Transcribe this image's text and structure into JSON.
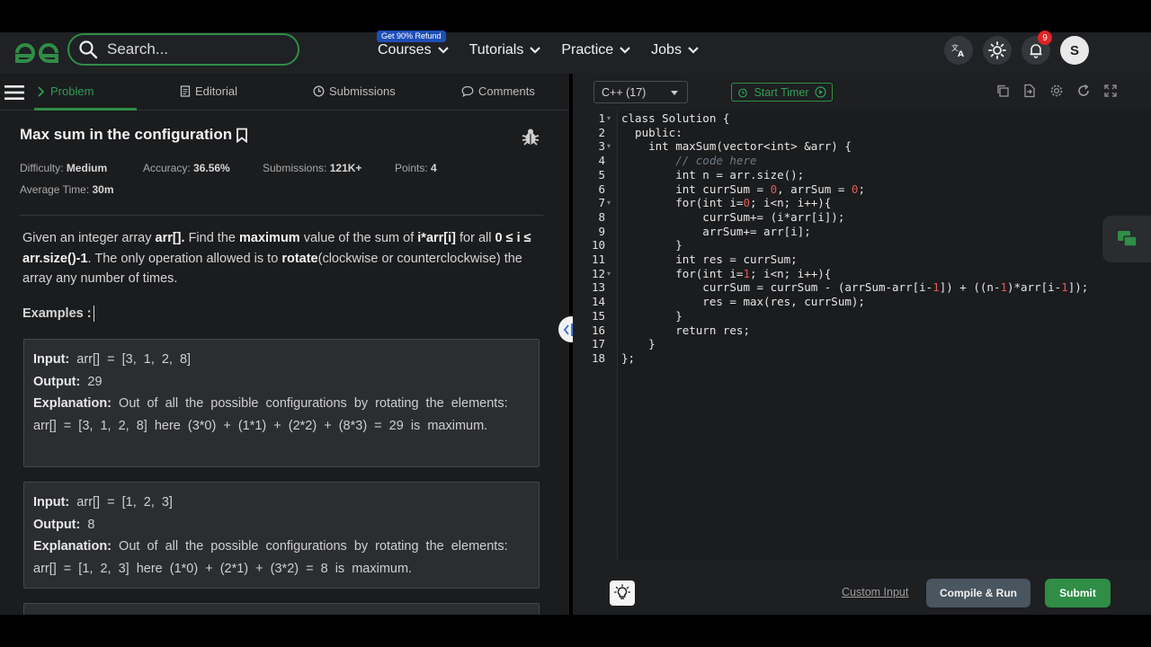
{
  "nav": {
    "search_placeholder": "Search...",
    "refund_badge": "Get 90% Refund",
    "menu": [
      "Courses",
      "Tutorials",
      "Practice",
      "Jobs"
    ],
    "notification_count": "9",
    "avatar_initial": "S",
    "brand_color": "#2f8d46"
  },
  "tabs": {
    "problem": "Problem",
    "editorial": "Editorial",
    "submissions": "Submissions",
    "comments": "Comments"
  },
  "problem": {
    "title": "Max sum in the configuration",
    "difficulty_label": "Difficulty:",
    "difficulty": "Medium",
    "accuracy_label": "Accuracy:",
    "accuracy": "36.56%",
    "submissions_label": "Submissions:",
    "submissions": "121K+",
    "points_label": "Points:",
    "points": "4",
    "avg_time_label": "Average Time:",
    "avg_time": "30m",
    "desc_1": "Given an integer array ",
    "desc_arr": "arr[].",
    "desc_2": " Find the ",
    "desc_max": "maximum",
    "desc_3": " value of the sum of ",
    "desc_expr": "i*arr[i]",
    "desc_4": " for all ",
    "desc_range": "0 ≤ i ≤ arr.size()-1",
    "desc_5": ". The only operation allowed is to ",
    "desc_rotate": "rotate",
    "desc_6": "(clockwise or counterclockwise) the array any number of times.",
    "examples_label": "Examples :",
    "examples": [
      {
        "input_label": "Input:",
        "input": "arr[] = [3, 1, 2, 8]",
        "output_label": "Output:",
        "output": "29",
        "explanation_label": "Explanation:",
        "explanation": "Out of all the possible configurations by rotating the elements: arr[] = [3, 1, 2, 8] here (3*0) + (1*1) + (2*2) + (8*3) = 29 is maximum."
      },
      {
        "input_label": "Input:",
        "input": "arr[] = [1, 2, 3]",
        "output_label": "Output:",
        "output": "8",
        "explanation_label": "Explanation:",
        "explanation": "Out of all the possible configurations by rotating the elements: arr[] = [1, 2, 3] here (1*0) + (2*1) + (3*2) = 8 is maximum."
      }
    ]
  },
  "editor": {
    "language": "C++ (17)",
    "timer_label": "Start Timer",
    "custom_input": "Custom Input",
    "compile_run": "Compile & Run",
    "submit": "Submit",
    "code_lines": [
      "class Solution {",
      "  public:",
      "    int maxSum(vector<int> &arr) {",
      "        // code here",
      "        int n = arr.size();",
      "        int currSum = 0, arrSum = 0;",
      "        for(int i=0; i<n; i++){",
      "            currSum+= (i*arr[i]);",
      "            arrSum+= arr[i];",
      "        }",
      "        int res = currSum;",
      "        for(int i=1; i<n; i++){",
      "            currSum = currSum - (arrSum-arr[i-1]) + ((n-1)*arr[i-1]);",
      "            res = max(res, currSum);",
      "        }",
      "        return res;",
      "    }",
      "};"
    ],
    "fold_lines": [
      1,
      3,
      7,
      12
    ]
  }
}
